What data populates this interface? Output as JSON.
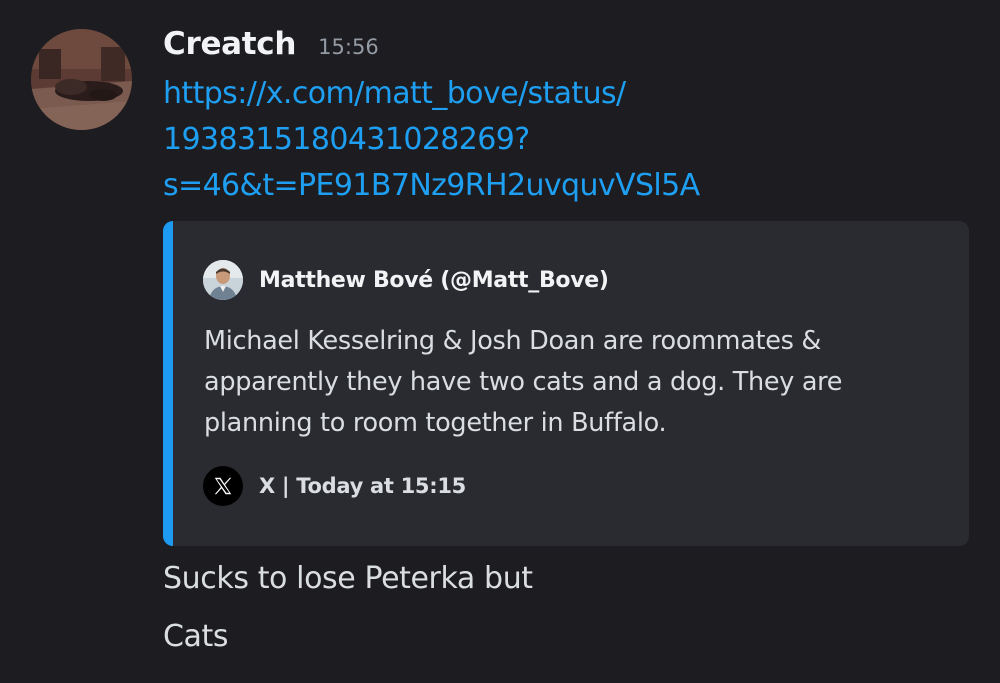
{
  "message": {
    "username": "Creatch",
    "timestamp": "15:56",
    "avatar_icon": "user-avatar-icon",
    "link_lines": [
      "https://x.com/matt_bove/status/",
      "1938315180431028269?",
      "s=46&t=PE91B7Nz9RH2uvquvVSl5A"
    ]
  },
  "embed": {
    "accent_color": "#1d9bf0",
    "author": "Matthew Bové (@Matt_Bove)",
    "author_icon": "author-avatar-icon",
    "description_lines": [
      "Michael Kesselring & Josh Doan are roommates &",
      "apparently they have two cats and a dog. They are",
      "planning to room together in Buffalo."
    ],
    "footer_icon": "x-logo-icon",
    "footer_text": "X | Today at 15:15"
  },
  "followups": [
    "Sucks to lose Peterka but",
    "Cats"
  ],
  "colors": {
    "background": "#1c1c21",
    "embed_background": "#2a2b31",
    "link": "#1e9ff2",
    "text": "#dbdee1",
    "muted": "#949ba4"
  }
}
